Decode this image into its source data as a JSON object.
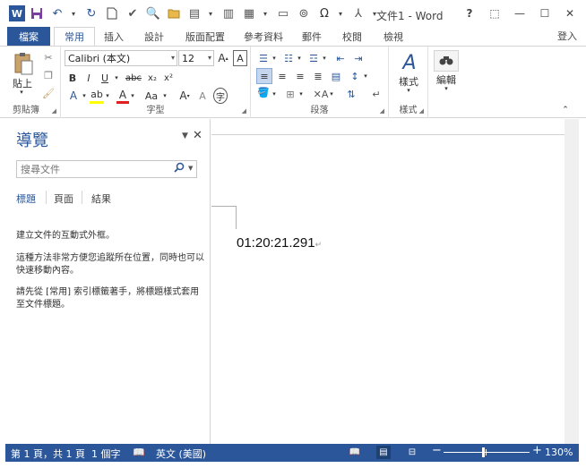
{
  "window": {
    "title": "文件1 - Word",
    "help": "?",
    "controls": {
      "restore_ribbon": "⬚",
      "minimize": "—",
      "maximize": "☐",
      "close": "✕"
    }
  },
  "qat": {
    "icons": [
      "word-icon",
      "save-icon",
      "undo-icon",
      "redo-icon",
      "new-doc-icon",
      "spellcheck-icon",
      "print-preview-icon",
      "open-icon",
      "textbox-icon",
      "table-icon",
      "layout-icon",
      "link-icon",
      "symbol-icon",
      "structure-icon",
      "customize-qat-icon"
    ]
  },
  "tabs": {
    "file": "檔案",
    "items": [
      "常用",
      "插入",
      "設計",
      "版面配置",
      "參考資料",
      "郵件",
      "校閱",
      "檢視"
    ],
    "active": "常用",
    "signin": "登入"
  },
  "ribbon": {
    "clipboard": {
      "paste": "貼上",
      "label": "剪貼簿"
    },
    "font": {
      "name": "Calibri (本文)",
      "size": "12",
      "label": "字型",
      "buttons": [
        "B",
        "I",
        "U",
        "abc",
        "x₂",
        "x²",
        "A",
        "Aa",
        "A",
        "A"
      ]
    },
    "paragraph": {
      "label": "段落"
    },
    "styles": {
      "button": "樣式",
      "label": "樣式"
    },
    "editing": {
      "button": "編輯"
    },
    "accent_color": "#2b579a"
  },
  "nav": {
    "title": "導覽",
    "search_placeholder": "搜尋文件",
    "tabs": [
      "標題",
      "頁面",
      "結果"
    ],
    "active_tab": "標題",
    "texts": [
      "建立文件的互動式外框。",
      "這種方法非常方便您追蹤所在位置，同時也可以快速移動內容。",
      "請先從 [常用] 索引標籤著手，將標題樣式套用至文件標題。"
    ]
  },
  "document": {
    "text": "01:20:21.291",
    "para_mark": "↵"
  },
  "status": {
    "page": "第 1 頁，共 1 頁",
    "words": "1 個字",
    "language": "英文 (美國)",
    "zoom": "130%",
    "zoom_minus": "−",
    "zoom_plus": "+",
    "zoom_level": 0.46,
    "bar_color": "#2b579a"
  }
}
